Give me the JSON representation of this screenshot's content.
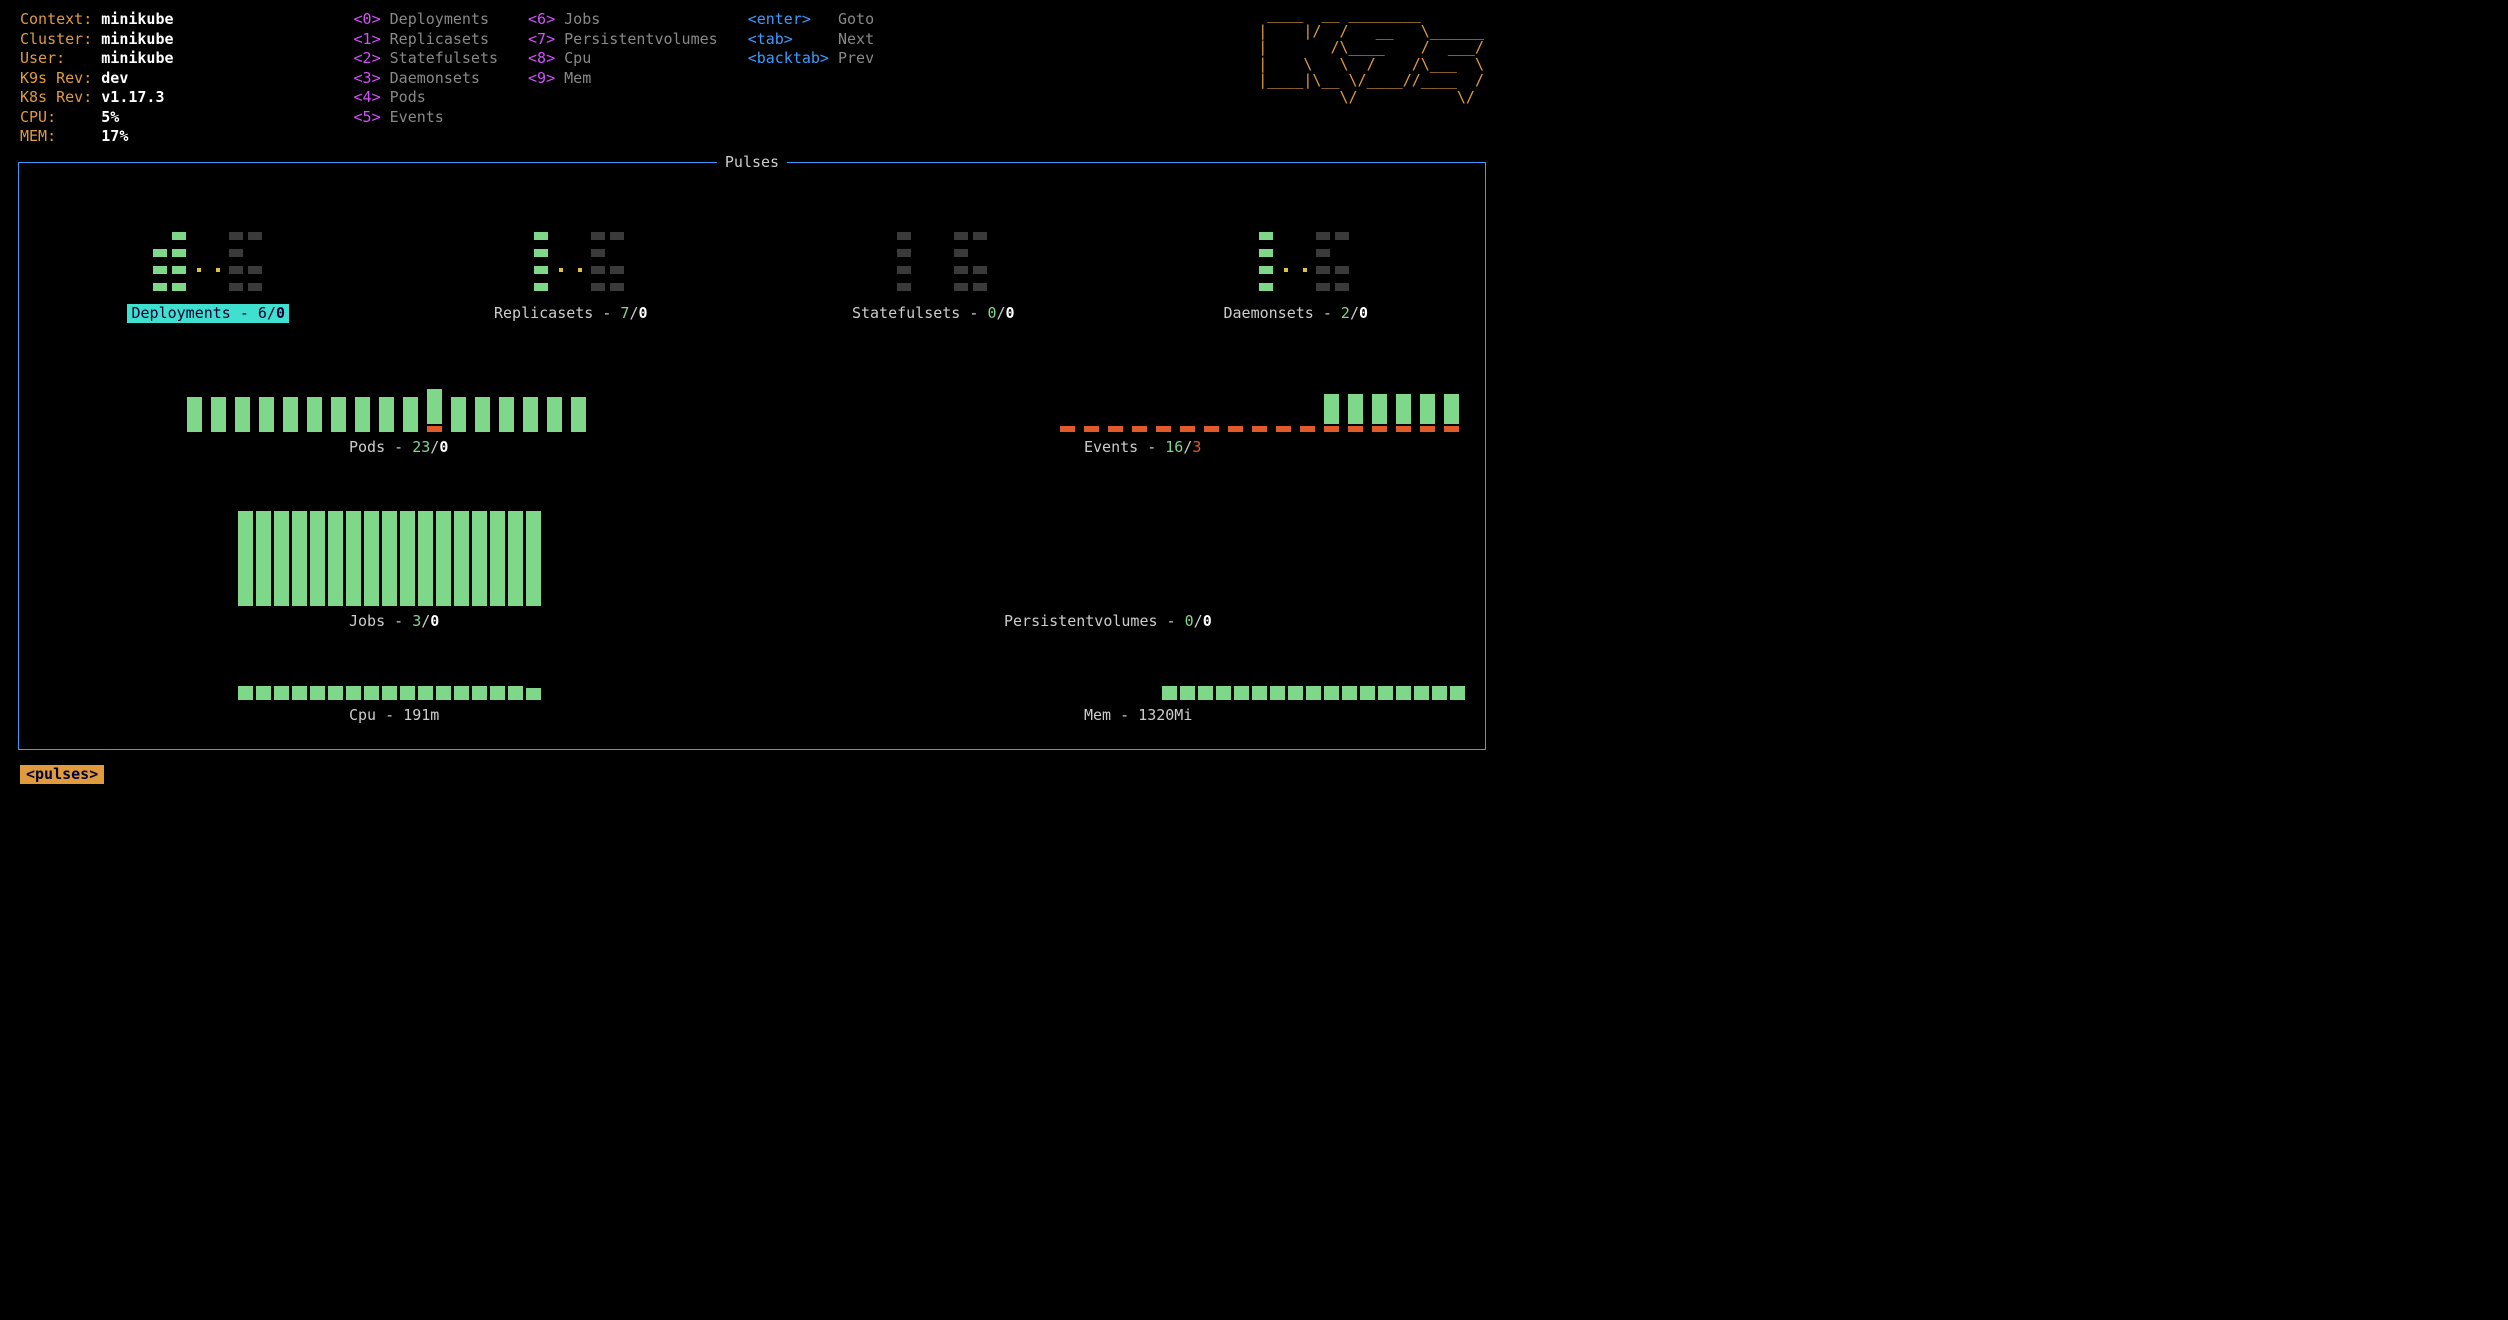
{
  "info": {
    "context_label": "Context:",
    "context_value": "minikube",
    "cluster_label": "Cluster:",
    "cluster_value": "minikube",
    "user_label": "User:",
    "user_value": "minikube",
    "k9srev_label": "K9s Rev:",
    "k9srev_value": "dev",
    "k8srev_label": "K8s Rev:",
    "k8srev_value": "v1.17.3",
    "cpu_label": "CPU:",
    "cpu_value": "5%",
    "mem_label": "MEM:",
    "mem_value": "17%"
  },
  "hotkeys": {
    "col1": [
      {
        "key": "<0>",
        "label": "Deployments"
      },
      {
        "key": "<1>",
        "label": "Replicasets"
      },
      {
        "key": "<2>",
        "label": "Statefulsets"
      },
      {
        "key": "<3>",
        "label": "Daemonsets"
      },
      {
        "key": "<4>",
        "label": "Pods"
      },
      {
        "key": "<5>",
        "label": "Events"
      }
    ],
    "col2": [
      {
        "key": "<6>",
        "label": "Jobs"
      },
      {
        "key": "<7>",
        "label": "Persistentvolumes"
      },
      {
        "key": "<8>",
        "label": "Cpu"
      },
      {
        "key": "<9>",
        "label": "Mem"
      }
    ],
    "col3": [
      {
        "key": "<enter>",
        "label": "Goto"
      },
      {
        "key": "<tab>",
        "label": "Next"
      },
      {
        "key": "<backtab>",
        "label": "Prev"
      }
    ]
  },
  "logo_ascii": " ____  __ ________       \n|    |/  /   __   \\______\n|       /\\____    /  ___/\n|    \\   \\  /    /\\___  \\\n|____|\\__ \\/____//____  /\n         \\/           \\/ ",
  "panel_title": "Pulses",
  "pulses": {
    "deployments": {
      "label": "Deployments",
      "ok": "6",
      "bad": "0",
      "selected": true
    },
    "replicasets": {
      "label": "Replicasets",
      "ok": "7",
      "bad": "0"
    },
    "statefulsets": {
      "label": "Statefulsets",
      "ok": "0",
      "bad": "0"
    },
    "daemonsets": {
      "label": "Daemonsets",
      "ok": "2",
      "bad": "0"
    },
    "pods": {
      "label": "Pods",
      "ok": "23",
      "bad": "0"
    },
    "events": {
      "label": "Events",
      "ok": "16",
      "bad": "3"
    },
    "jobs": {
      "label": "Jobs",
      "ok": "3",
      "bad": "0"
    },
    "pvs": {
      "label": "Persistentvolumes",
      "ok": "0",
      "bad": "0"
    },
    "cpu": {
      "label": "Cpu",
      "value": "191m"
    },
    "mem": {
      "label": "Mem",
      "value": "1320Mi"
    }
  },
  "chart_data": [
    {
      "type": "bar",
      "title": "Pods",
      "series": [
        {
          "name": "ok",
          "values": [
            58,
            58,
            58,
            58,
            58,
            58,
            58,
            58,
            58,
            58,
            58,
            58,
            58,
            58,
            58,
            58,
            58
          ]
        },
        {
          "name": "fault",
          "values": [
            0,
            0,
            0,
            0,
            0,
            0,
            0,
            0,
            0,
            0,
            10,
            0,
            0,
            0,
            0,
            0,
            0
          ]
        }
      ]
    },
    {
      "type": "bar",
      "title": "Events",
      "series": [
        {
          "name": "ok",
          "values": [
            0,
            0,
            0,
            0,
            0,
            0,
            0,
            0,
            0,
            0,
            0,
            50,
            50,
            50,
            50,
            50,
            50
          ]
        },
        {
          "name": "fault",
          "values": [
            10,
            10,
            10,
            10,
            10,
            10,
            10,
            10,
            10,
            10,
            10,
            10,
            10,
            10,
            10,
            10,
            10
          ]
        }
      ]
    },
    {
      "type": "bar",
      "title": "Jobs",
      "values": [
        95,
        95,
        95,
        95,
        95,
        95,
        95,
        95,
        95,
        95,
        95,
        95,
        95,
        95,
        95,
        95,
        95
      ]
    },
    {
      "type": "bar",
      "title": "Cpu",
      "values": [
        35,
        35,
        35,
        35,
        35,
        35,
        35,
        35,
        35,
        35,
        35,
        35,
        35,
        35,
        35,
        35,
        28
      ]
    },
    {
      "type": "bar",
      "title": "Mem",
      "values": [
        35,
        35,
        35,
        35,
        35,
        35,
        35,
        35,
        35,
        35,
        35,
        35,
        35,
        35,
        35,
        35,
        35
      ]
    }
  ],
  "crumb": "<pulses>"
}
